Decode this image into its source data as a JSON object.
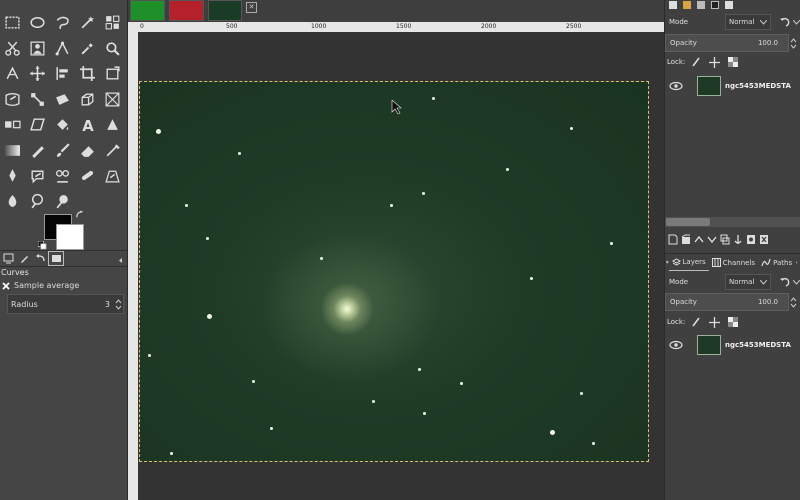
{
  "image_tabs": {
    "close_glyph": "✕"
  },
  "ruler": {
    "h_labels": [
      "0",
      "500",
      "1000",
      "1500",
      "2000",
      "2500"
    ]
  },
  "tool_options": {
    "title": "Curves",
    "sample_label": "Sample average",
    "sample_checked": true,
    "radius_label": "Radius",
    "radius_value": "3"
  },
  "layers_top": {
    "mode_label": "Mode",
    "mode_value": "Normal",
    "opacity_label": "Opacity",
    "opacity_value": "100.0",
    "lock_label": "Lock:",
    "layer_name": "ngc5453MEDSTA"
  },
  "dock_tabs": [
    {
      "label": "Layers",
      "icon": "layers-icon"
    },
    {
      "label": "Channels",
      "icon": "channels-icon"
    },
    {
      "label": "Paths",
      "icon": "paths-icon"
    }
  ],
  "layers_bottom": {
    "mode_label": "Mode",
    "mode_value": "Normal",
    "opacity_label": "Opacity",
    "opacity_value": "100.0",
    "lock_label": "Lock:",
    "layer_name": "ngc5453MEDSTA"
  },
  "colors": {
    "foreground": "#050505",
    "background": "#ffffff",
    "selection_outline": "#d8c36a"
  }
}
